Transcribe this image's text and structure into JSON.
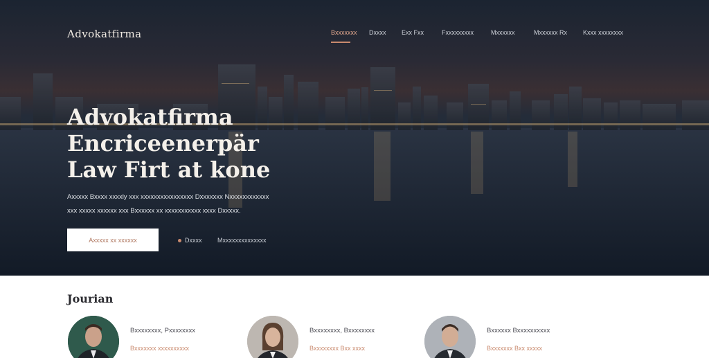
{
  "header": {
    "brand": "Advokatfirma",
    "nav": [
      {
        "label": "Bxxxxxxx",
        "active": true
      },
      {
        "label": "Dxxxx",
        "active": false
      },
      {
        "label": "Exx Fxx",
        "active": false
      },
      {
        "label": "Fxxxxxxxxx",
        "active": false
      },
      {
        "label": "Mxxxxxx",
        "active": false
      },
      {
        "label": "Mxxxxxx Rx",
        "active": false
      },
      {
        "label": "Kxxx xxxxxxxx",
        "active": false
      }
    ]
  },
  "hero": {
    "headline": [
      "Advokatfirma",
      "Encriceenerpär",
      "Law Firt at kone"
    ],
    "subtext": [
      "Axxxxx Bxxxx xxxxly xxx xxxxxxxxxxxxxxxx Dxxxxxxx Nxxxxxxxxxxxx",
      "xxx xxxxx xxxxxx xxx Bxxxxxx xx xxxxxxxxxxx xxxx Dxxxxx."
    ],
    "cta_label": "Axxxxx xx xxxxxx",
    "secondary_links": [
      "Dxxxx",
      "Mxxxxxxxxxxxxxx"
    ]
  },
  "team": {
    "title": "Jourian",
    "members": [
      {
        "name": "Bxxxxxxxx, Pxxxxxxxx",
        "role": "Bxxxxxxx xxxxxxxxxx"
      },
      {
        "name": "Bxxxxxxxx, Bxxxxxxxx",
        "role": "Bxxxxxxxx Bxx xxxx"
      },
      {
        "name": "Bxxxxxx Bxxxxxxxxxx",
        "role": "Bxxxxxxx Bxx xxxxx"
      }
    ]
  },
  "colors": {
    "accent": "#c98a6e",
    "hero_bg": "#1c2736",
    "headline": "#f4f0ea"
  }
}
